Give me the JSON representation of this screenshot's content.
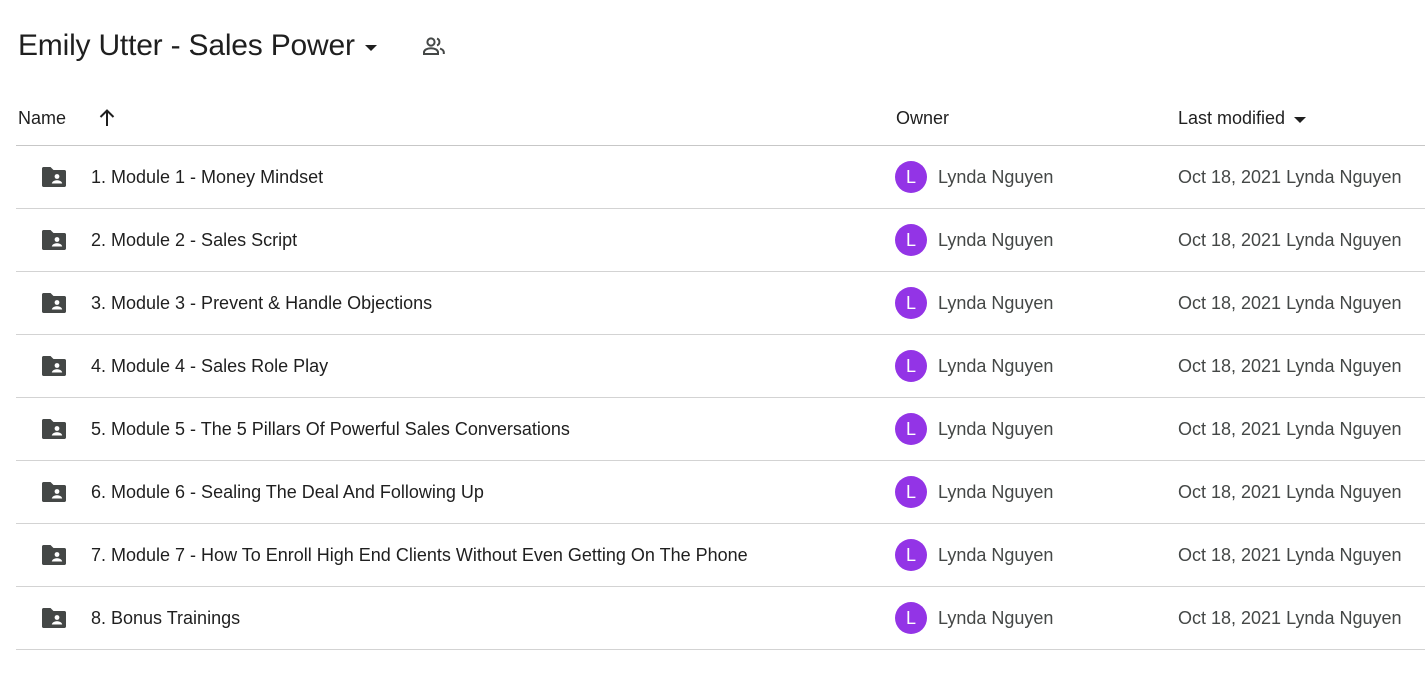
{
  "header": {
    "title": "Emily Utter - Sales Power",
    "title_caret_icon": "caret-down-icon",
    "shared_icon": "people-icon"
  },
  "columns": {
    "name": "Name",
    "name_sort_icon": "arrow-up-icon",
    "owner": "Owner",
    "last_modified": "Last modified",
    "last_modified_caret_icon": "caret-down-icon"
  },
  "colors": {
    "avatar_bg": "#9334e6",
    "folder_icon": "#444746",
    "divider": "#d3d3d3"
  },
  "rows": [
    {
      "icon": "shared-folder-icon",
      "name": "1. Module 1 - Money Mindset",
      "avatar_letter": "L",
      "owner": "Lynda Nguyen",
      "modified_date": "Oct 18, 2021",
      "modified_by": "Lynda Nguyen"
    },
    {
      "icon": "shared-folder-icon",
      "name": "2. Module 2 - Sales Script",
      "avatar_letter": "L",
      "owner": "Lynda Nguyen",
      "modified_date": "Oct 18, 2021",
      "modified_by": "Lynda Nguyen"
    },
    {
      "icon": "shared-folder-icon",
      "name": "3. Module 3 - Prevent & Handle Objections",
      "avatar_letter": "L",
      "owner": "Lynda Nguyen",
      "modified_date": "Oct 18, 2021",
      "modified_by": "Lynda Nguyen"
    },
    {
      "icon": "shared-folder-icon",
      "name": "4. Module 4 - Sales Role Play",
      "avatar_letter": "L",
      "owner": "Lynda Nguyen",
      "modified_date": "Oct 18, 2021",
      "modified_by": "Lynda Nguyen"
    },
    {
      "icon": "shared-folder-icon",
      "name": "5. Module 5 - The 5 Pillars Of Powerful Sales Conversations",
      "avatar_letter": "L",
      "owner": "Lynda Nguyen",
      "modified_date": "Oct 18, 2021",
      "modified_by": "Lynda Nguyen"
    },
    {
      "icon": "shared-folder-icon",
      "name": "6. Module 6 - Sealing The Deal And Following Up",
      "avatar_letter": "L",
      "owner": "Lynda Nguyen",
      "modified_date": "Oct 18, 2021",
      "modified_by": "Lynda Nguyen"
    },
    {
      "icon": "shared-folder-icon",
      "name": "7. Module 7 - How To Enroll High End Clients Without Even Getting On The Phone",
      "avatar_letter": "L",
      "owner": "Lynda Nguyen",
      "modified_date": "Oct 18, 2021",
      "modified_by": "Lynda Nguyen"
    },
    {
      "icon": "shared-folder-icon",
      "name": "8. Bonus Trainings",
      "avatar_letter": "L",
      "owner": "Lynda Nguyen",
      "modified_date": "Oct 18, 2021",
      "modified_by": "Lynda Nguyen"
    }
  ]
}
